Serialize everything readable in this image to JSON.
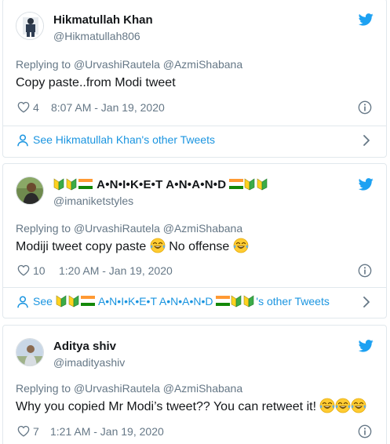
{
  "tweets": [
    {
      "display_name": "Hikmatullah Khan",
      "handle": "@Hikmatullah806",
      "replying_prefix": "Replying to",
      "mentions": [
        "@UrvashiRautela",
        "@AzmiShabana"
      ],
      "text": "Copy paste..from Modi tweet",
      "likes": "4",
      "timestamp": "8:07 AM - Jan 19, 2020",
      "other_tweets_label": "See Hikmatullah Khan's other Tweets"
    },
    {
      "display_name": "A•N•I•K•E•T A•N•A•N•D",
      "handle": "@imaniketstyles",
      "replying_prefix": "Replying to",
      "mentions": [
        "@UrvashiRautela",
        "@AzmiShabana"
      ],
      "text": "Modiji tweet copy paste",
      "text_2": "No offense",
      "likes": "10",
      "timestamp": "1:20 AM - Jan 19, 2020",
      "other_tweets_prefix": "See",
      "other_tweets_suffix": "'s other Tweets"
    },
    {
      "display_name": "Aditya shiv",
      "handle": "@imadityashiv",
      "replying_prefix": "Replying to",
      "mentions": [
        "@UrvashiRautela",
        "@AzmiShabana"
      ],
      "text": "Why you copied Mr Modi’s tweet?? You can retweet it!",
      "likes": "7",
      "timestamp": "1:21 AM - Jan 19, 2020"
    }
  ],
  "icons": {
    "brand": "twitter-bird-icon",
    "like": "heart-icon",
    "info": "info-icon",
    "profile": "person-icon",
    "next": "chevron-right-icon",
    "emoji": "face-with-tears-of-joy-icon",
    "badge": "beginner-leaf-icon",
    "flag": "india-flag-icon"
  },
  "colors": {
    "twitter_blue": "#1da1f2",
    "link_blue": "#1b95e0",
    "secondary_text": "#657786",
    "border": "#e1e8ed"
  }
}
